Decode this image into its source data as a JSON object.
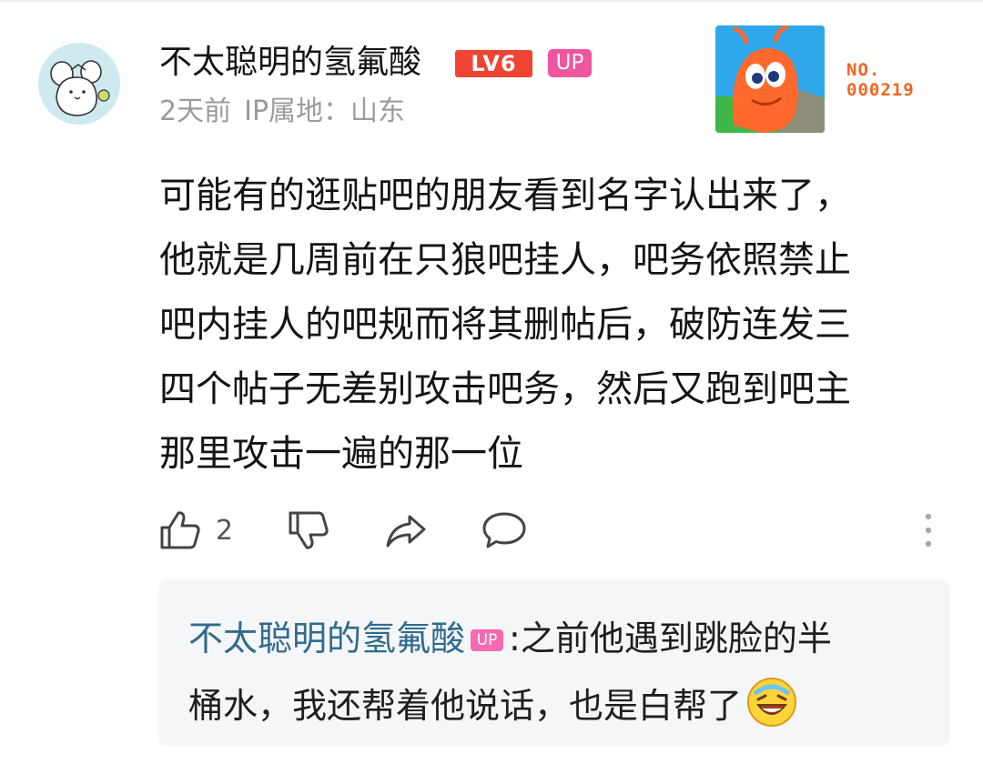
{
  "comment": {
    "username": "不太聪明的氢氟酸",
    "level_badge": "LV6",
    "up_badge": "UP",
    "time": "2天前",
    "ip_location": "IP属地：山东",
    "fan_card_no_label": "NO.",
    "fan_card_no_value": "000219",
    "lines": [
      "可能有的逛贴吧的朋友看到名字认出来了，",
      "他就是几周前在只狼吧挂人，吧务依照禁止",
      "吧内挂人的吧规而将其删帖后，破防连发三",
      "四个帖子无差别攻击吧务，然后又跑到吧主",
      "那里攻击一遍的那一位"
    ]
  },
  "actions": {
    "like_count": "2",
    "icons": [
      "thumbs-up-icon",
      "thumbs-down-icon",
      "share-icon",
      "reply-icon",
      "more-icon"
    ]
  },
  "reply": {
    "username": "不太聪明的氢氟酸",
    "up_badge": "UP",
    "separator": ":",
    "line1": "之前他遇到跳脸的半",
    "line2": "桶水，我还帮着他说话，也是白帮了",
    "emoji": "laughing-crying-emoji"
  },
  "colors": {
    "level_badge": "#ef4334",
    "up_badge": "#f0559f",
    "reply_username": "#2f6c8e",
    "meta_text": "#9b9b9b",
    "fan_no": "#f26422"
  }
}
